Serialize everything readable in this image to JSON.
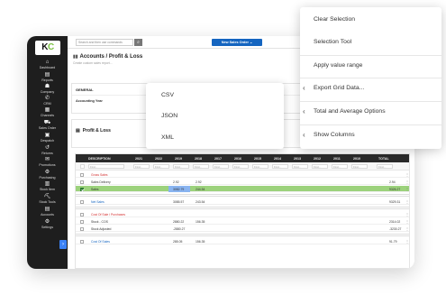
{
  "app": {
    "logo_text_k": "K",
    "logo_text_c": "C"
  },
  "sidebar": {
    "items": [
      {
        "label": "Dashboard",
        "icon": "home-icon",
        "glyph": "⌂"
      },
      {
        "label": "Reports",
        "icon": "report-icon",
        "glyph": "▤"
      },
      {
        "label": "Company",
        "icon": "company-icon",
        "glyph": "☗"
      },
      {
        "label": "CRM",
        "icon": "phone-icon",
        "glyph": "✆"
      },
      {
        "label": "Channels",
        "icon": "channels-icon",
        "glyph": "▦"
      },
      {
        "label": "Sales Order",
        "icon": "cart-icon",
        "glyph": "⛟"
      },
      {
        "label": "Despatch",
        "icon": "despatch-icon",
        "glyph": "▣"
      },
      {
        "label": "Returns",
        "icon": "returns-icon",
        "glyph": "↺"
      },
      {
        "label": "Promotions",
        "icon": "promotions-icon",
        "glyph": "✉"
      },
      {
        "label": "Purchasing",
        "icon": "purchasing-icon",
        "glyph": "⚙"
      },
      {
        "label": "Stock Item",
        "icon": "stock-item-icon",
        "glyph": "▥"
      },
      {
        "label": "Stock Tools",
        "icon": "stock-tools-icon",
        "glyph": "⛏"
      },
      {
        "label": "Accounts",
        "icon": "accounts-icon",
        "glyph": "▤"
      },
      {
        "label": "Settings",
        "icon": "settings-icon",
        "glyph": "⚙"
      }
    ],
    "collapse_glyph": "›"
  },
  "topbar": {
    "search_placeholder": "Search and then use commands",
    "search_glyph": "⌕",
    "new_order_label": "New Sales Order ⌄"
  },
  "page": {
    "breadcrumb": "Accounts / Profit & Loss",
    "subtitle": "Create custom sales report..."
  },
  "general_panel": {
    "heading": "GENERAL",
    "accounting_year_label": "Accounting Year"
  },
  "pl_panel": {
    "heading": "Profit & Loss"
  },
  "grid": {
    "columns": [
      "DESCRIPTION",
      "2021",
      "2022",
      "2019",
      "2018",
      "2017",
      "2016",
      "2015",
      "2014",
      "2013",
      "2012",
      "2011",
      "2010",
      "TOTAL"
    ],
    "filter_placeholders": [
      "Find...",
      "Find...",
      "Find...",
      "Find...",
      "Find...",
      "Find...",
      "Find...",
      "Find...",
      "Find...",
      "Find...",
      "Find...",
      "Find...",
      "Find...",
      "Find..."
    ],
    "rows": [
      {
        "style": "red",
        "desc": "Gross Sales",
        "v2022": "",
        "v2019": "",
        "total": ""
      },
      {
        "style": "",
        "desc": "Sales Delivery",
        "v2022": "2.92",
        "v2019": "2.92",
        "total": "2.94"
      },
      {
        "style": "sel",
        "desc": "Sales",
        "v2022": "3082.79",
        "v2019": "244.54",
        "total": "9326.27"
      },
      {
        "style": "sep"
      },
      {
        "style": "blue",
        "desc": "Net Sales",
        "v2022": "3085.57",
        "v2019": "243.54",
        "total": "9329.31"
      },
      {
        "style": "sep"
      },
      {
        "style": "red",
        "desc": "Cost Of Sale / Purchases",
        "v2022": "",
        "v2019": "",
        "total": ""
      },
      {
        "style": "",
        "desc": "Stock - COS",
        "v2022": "2880.22",
        "v2019": "156.35",
        "total": "2314.02"
      },
      {
        "style": "",
        "desc": "Stock Adjusted",
        "v2022": "-2880.27",
        "v2019": "",
        "total": "-3230.27"
      },
      {
        "style": "sep"
      },
      {
        "style": "blue",
        "desc": "Cost Of Sales",
        "v2022": "285.05",
        "v2019": "156.35",
        "total": "91.79"
      }
    ],
    "row_menu_glyph": "⋮"
  },
  "export_menu": {
    "items": [
      "CSV",
      "JSON",
      "XML"
    ]
  },
  "context_menu": {
    "items": [
      {
        "label": "Clear Selection",
        "submenu": false
      },
      {
        "label": "Selection Tool",
        "submenu": false
      },
      {
        "label": "Apply value range",
        "submenu": false
      },
      {
        "label": "Export Grid Data...",
        "submenu": true
      },
      {
        "label": "Total and Average Options",
        "submenu": true
      },
      {
        "label": "Show Columns",
        "submenu": true
      }
    ],
    "chevron_glyph": "‹"
  }
}
